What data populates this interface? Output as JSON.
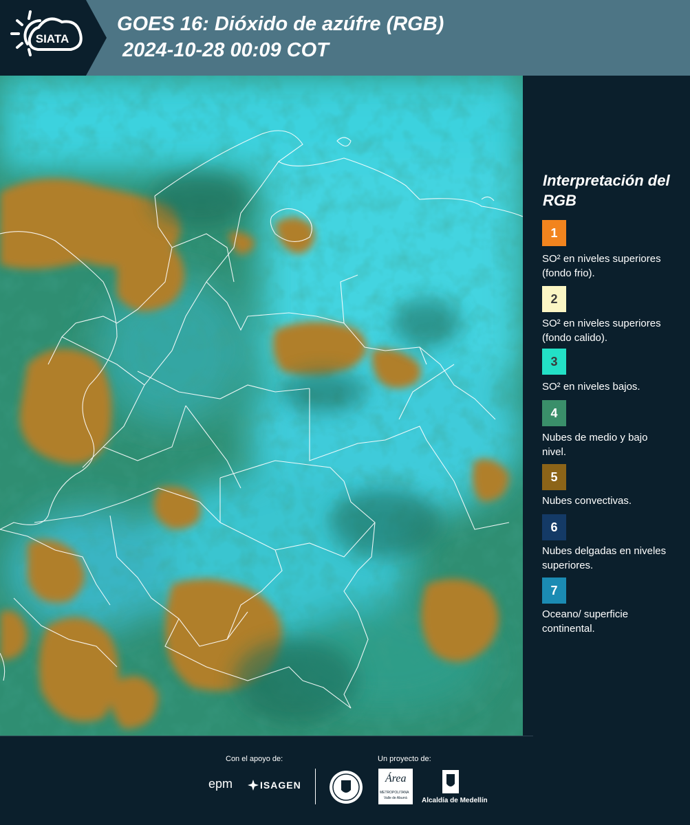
{
  "header": {
    "logo_text": "SIATA",
    "title": "GOES 16: Dióxido de azúfre (RGB)\n 2024-10-28 00:09 COT"
  },
  "legend": {
    "heading": "Interpretación del RGB",
    "items": [
      {
        "number": "1",
        "color": "#f2841e",
        "text": "SO² en niveles superiores (fondo frio)."
      },
      {
        "number": "2",
        "color": "#fbf6c4",
        "text": "SO² en niveles superiores (fondo calido)."
      },
      {
        "number": "3",
        "color": "#23e0c6",
        "text": "SO² en niveles bajos."
      },
      {
        "number": "4",
        "color": "#3a8f6a",
        "text": "Nubes de medio y bajo nivel."
      },
      {
        "number": "5",
        "color": "#8c6418",
        "text": "Nubes convectivas."
      },
      {
        "number": "6",
        "color": "#143a66",
        "text": "Nubes delgadas en niveles superiores."
      },
      {
        "number": "7",
        "color": "#1b8bb3",
        "text": "Oceano/ superficie continental."
      }
    ]
  },
  "footer": {
    "support_label": "Con el apoyo de:",
    "project_label": "Un proyecto de:",
    "sponsors": {
      "epm": "epm",
      "isagen": "ISAGEN",
      "area_metropolitana": "Área",
      "area_sub": "METROPOLITANA",
      "area_sub2": "Valle de Aburrá",
      "alcaldia": "Alcaldía de Medellín"
    }
  }
}
